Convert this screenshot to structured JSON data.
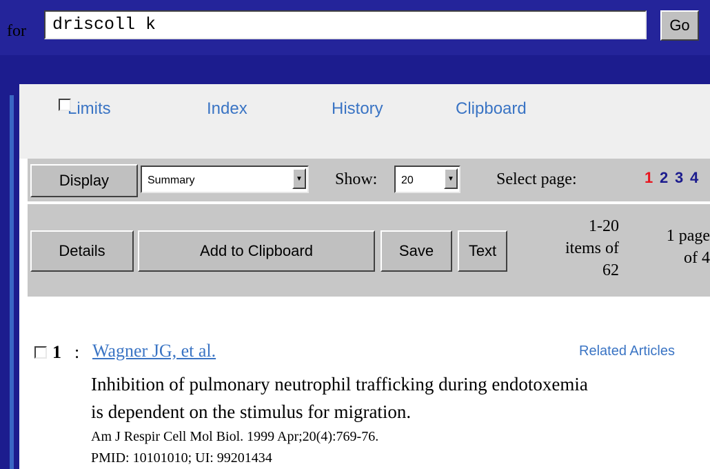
{
  "search": {
    "for_label": "for",
    "query": "driscoll k",
    "go_label": "Go"
  },
  "nav": {
    "limits": "Limits",
    "index": "Index",
    "history": "History",
    "clipboard": "Clipboard"
  },
  "display_bar": {
    "display_label": "Display",
    "format_value": "Summary",
    "show_label": "Show:",
    "show_value": "20",
    "select_page_label": "Select page:",
    "pages": [
      "1",
      "2",
      "3",
      "4"
    ],
    "current_page_color": "#e8141e",
    "other_page_color": "#1c1c8e"
  },
  "actions": {
    "details": "Details",
    "add_to_clipboard": "Add to Clipboard",
    "save": "Save",
    "text": "Text",
    "items_line1": "1-20",
    "items_line2": "items of",
    "items_line3": "62",
    "page_line1": "1 page",
    "page_line2": "of 4"
  },
  "results": [
    {
      "number": "1",
      "separator": ":",
      "authors": "Wagner JG, et al.",
      "related": "Related Articles",
      "title_line1": "Inhibition of pulmonary neutrophil trafficking during endotoxemia",
      "title_line2": "is dependent on the stimulus for migration.",
      "citation": "Am J Respir Cell Mol Biol. 1999 Apr;20(4):769-76.",
      "ids": "PMID: 10101010; UI: 99201434"
    }
  ]
}
